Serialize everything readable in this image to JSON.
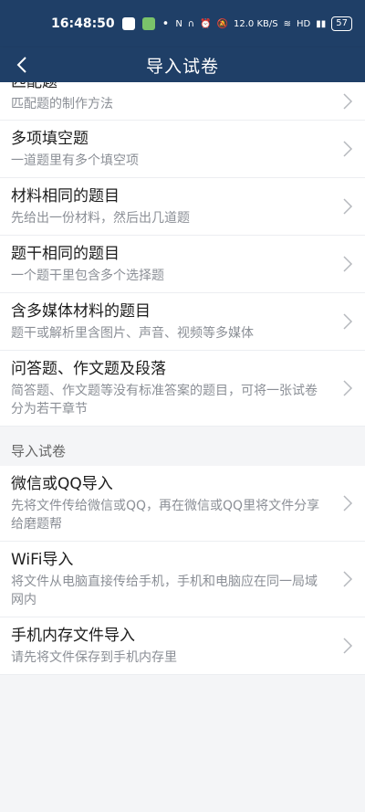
{
  "status_bar": {
    "time": "16:48:50",
    "speed": "12.0 KB/S",
    "battery": "57"
  },
  "app_bar": {
    "back_icon": "chevron-left-icon",
    "title": "导入试卷"
  },
  "question_types": [
    {
      "title": "匹配题",
      "desc": "匹配题的制作方法"
    },
    {
      "title": "多项填空题",
      "desc": "一道题里有多个填空项"
    },
    {
      "title": "材料相同的题目",
      "desc": "先给出一份材料，然后出几道题"
    },
    {
      "title": "题干相同的题目",
      "desc": "一个题干里包含多个选择题"
    },
    {
      "title": "含多媒体材料的题目",
      "desc": "题干或解析里含图片、声音、视频等多媒体"
    },
    {
      "title": "问答题、作文题及段落",
      "desc": "简答题、作文题等没有标准答案的题目，可将一张试卷分为若干章节"
    }
  ],
  "import_section": {
    "header": "导入试卷",
    "items": [
      {
        "title": "微信或QQ导入",
        "desc": "先将文件传给微信或QQ，再在微信或QQ里将文件分享给磨题帮"
      },
      {
        "title": "WiFi导入",
        "desc": "将文件从电脑直接传给手机，手机和电脑应在同一局域网内"
      },
      {
        "title": "手机内存文件导入",
        "desc": "请先将文件保存到手机内存里"
      }
    ]
  }
}
